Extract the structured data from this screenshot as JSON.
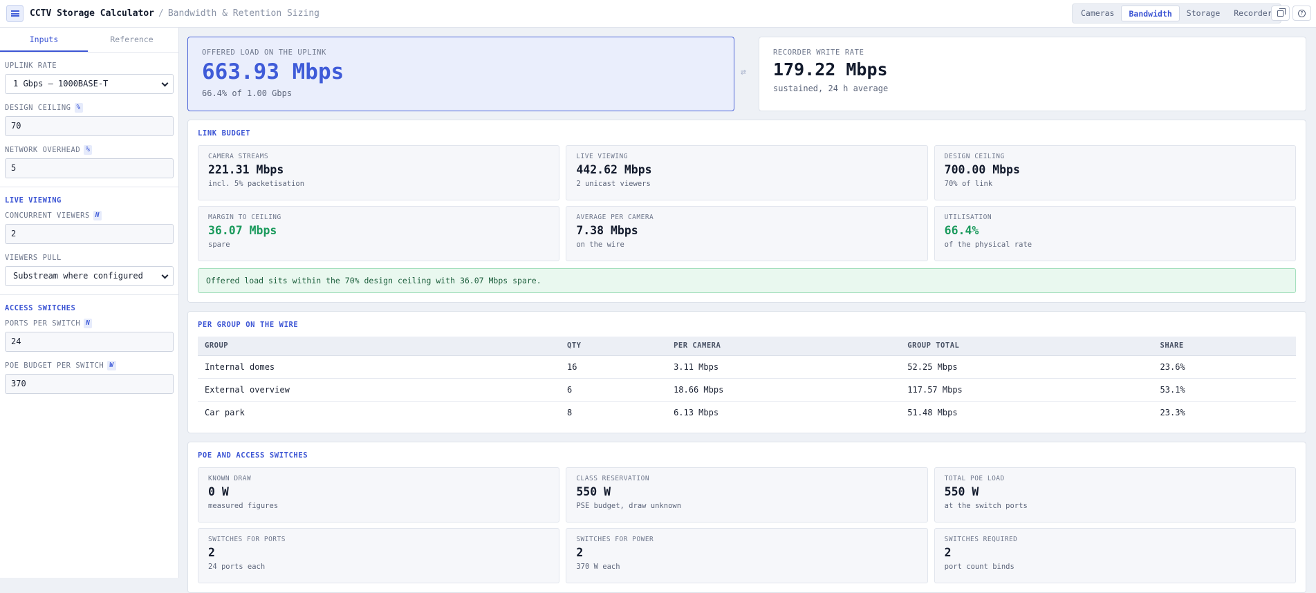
{
  "header": {
    "title": "CCTV Storage Calculator",
    "separator": "/",
    "subtitle": "Bandwidth & Retention Sizing",
    "tabs": [
      "Cameras",
      "Bandwidth",
      "Storage",
      "Recorder"
    ],
    "active_tab": "Bandwidth"
  },
  "sidebar": {
    "tabs": [
      "Inputs",
      "Reference"
    ],
    "active_tab": "Inputs",
    "uplink_rate": {
      "label": "UPLINK RATE",
      "value": "1 Gbps — 1000BASE-T"
    },
    "design_ceiling": {
      "label": "DESIGN CEILING",
      "unit": "%",
      "value": "70"
    },
    "network_overhead": {
      "label": "NETWORK OVERHEAD",
      "unit": "%",
      "value": "5"
    },
    "live_viewing_heading": "LIVE VIEWING",
    "concurrent_viewers": {
      "label": "CONCURRENT VIEWERS",
      "unit": "N",
      "value": "2"
    },
    "viewers_pull": {
      "label": "VIEWERS PULL",
      "value": "Substream where configured"
    },
    "access_switches_heading": "ACCESS SWITCHES",
    "ports_per_switch": {
      "label": "PORTS PER SWITCH",
      "unit": "N",
      "value": "24"
    },
    "poe_budget": {
      "label": "POE BUDGET PER SWITCH",
      "unit": "W",
      "value": "370"
    }
  },
  "hero": {
    "offered": {
      "label": "OFFERED LOAD ON THE UPLINK",
      "value": "663.93 Mbps",
      "sub": "66.4% of 1.00 Gbps"
    },
    "swap_glyph": "⇄",
    "recorder": {
      "label": "RECORDER WRITE RATE",
      "value": "179.22 Mbps",
      "sub": "sustained, 24 h average"
    }
  },
  "link_budget": {
    "title": "LINK BUDGET",
    "stats": [
      {
        "label": "CAMERA STREAMS",
        "value": "221.31 Mbps",
        "sub": "incl. 5% packetisation",
        "tone": "normal"
      },
      {
        "label": "LIVE VIEWING",
        "value": "442.62 Mbps",
        "sub": "2 unicast viewers",
        "tone": "normal"
      },
      {
        "label": "DESIGN CEILING",
        "value": "700.00 Mbps",
        "sub": "70% of link",
        "tone": "normal"
      },
      {
        "label": "MARGIN TO CEILING",
        "value": "36.07 Mbps",
        "sub": "spare",
        "tone": "good"
      },
      {
        "label": "AVERAGE PER CAMERA",
        "value": "7.38 Mbps",
        "sub": "on the wire",
        "tone": "normal"
      },
      {
        "label": "UTILISATION",
        "value": "66.4%",
        "sub": "of the physical rate",
        "tone": "good"
      }
    ],
    "notice": "Offered load sits within the 70% design ceiling with 36.07 Mbps spare."
  },
  "per_group": {
    "title": "PER GROUP ON THE WIRE",
    "columns": [
      "GROUP",
      "QTY",
      "PER CAMERA",
      "GROUP TOTAL",
      "SHARE"
    ],
    "rows": [
      [
        "Internal domes",
        "16",
        "3.11 Mbps",
        "52.25 Mbps",
        "23.6%"
      ],
      [
        "External overview",
        "6",
        "18.66 Mbps",
        "117.57 Mbps",
        "53.1%"
      ],
      [
        "Car park",
        "8",
        "6.13 Mbps",
        "51.48 Mbps",
        "23.3%"
      ]
    ]
  },
  "poe": {
    "title": "POE AND ACCESS SWITCHES",
    "stats": [
      {
        "label": "KNOWN DRAW",
        "value": "0 W",
        "sub": "measured figures"
      },
      {
        "label": "CLASS RESERVATION",
        "value": "550 W",
        "sub": "PSE budget, draw unknown"
      },
      {
        "label": "TOTAL POE LOAD",
        "value": "550 W",
        "sub": "at the switch ports"
      },
      {
        "label": "SWITCHES FOR PORTS",
        "value": "2",
        "sub": "24 ports each"
      },
      {
        "label": "SWITCHES FOR POWER",
        "value": "2",
        "sub": "370 W each"
      },
      {
        "label": "SWITCHES REQUIRED",
        "value": "2",
        "sub": "port count binds"
      }
    ]
  }
}
